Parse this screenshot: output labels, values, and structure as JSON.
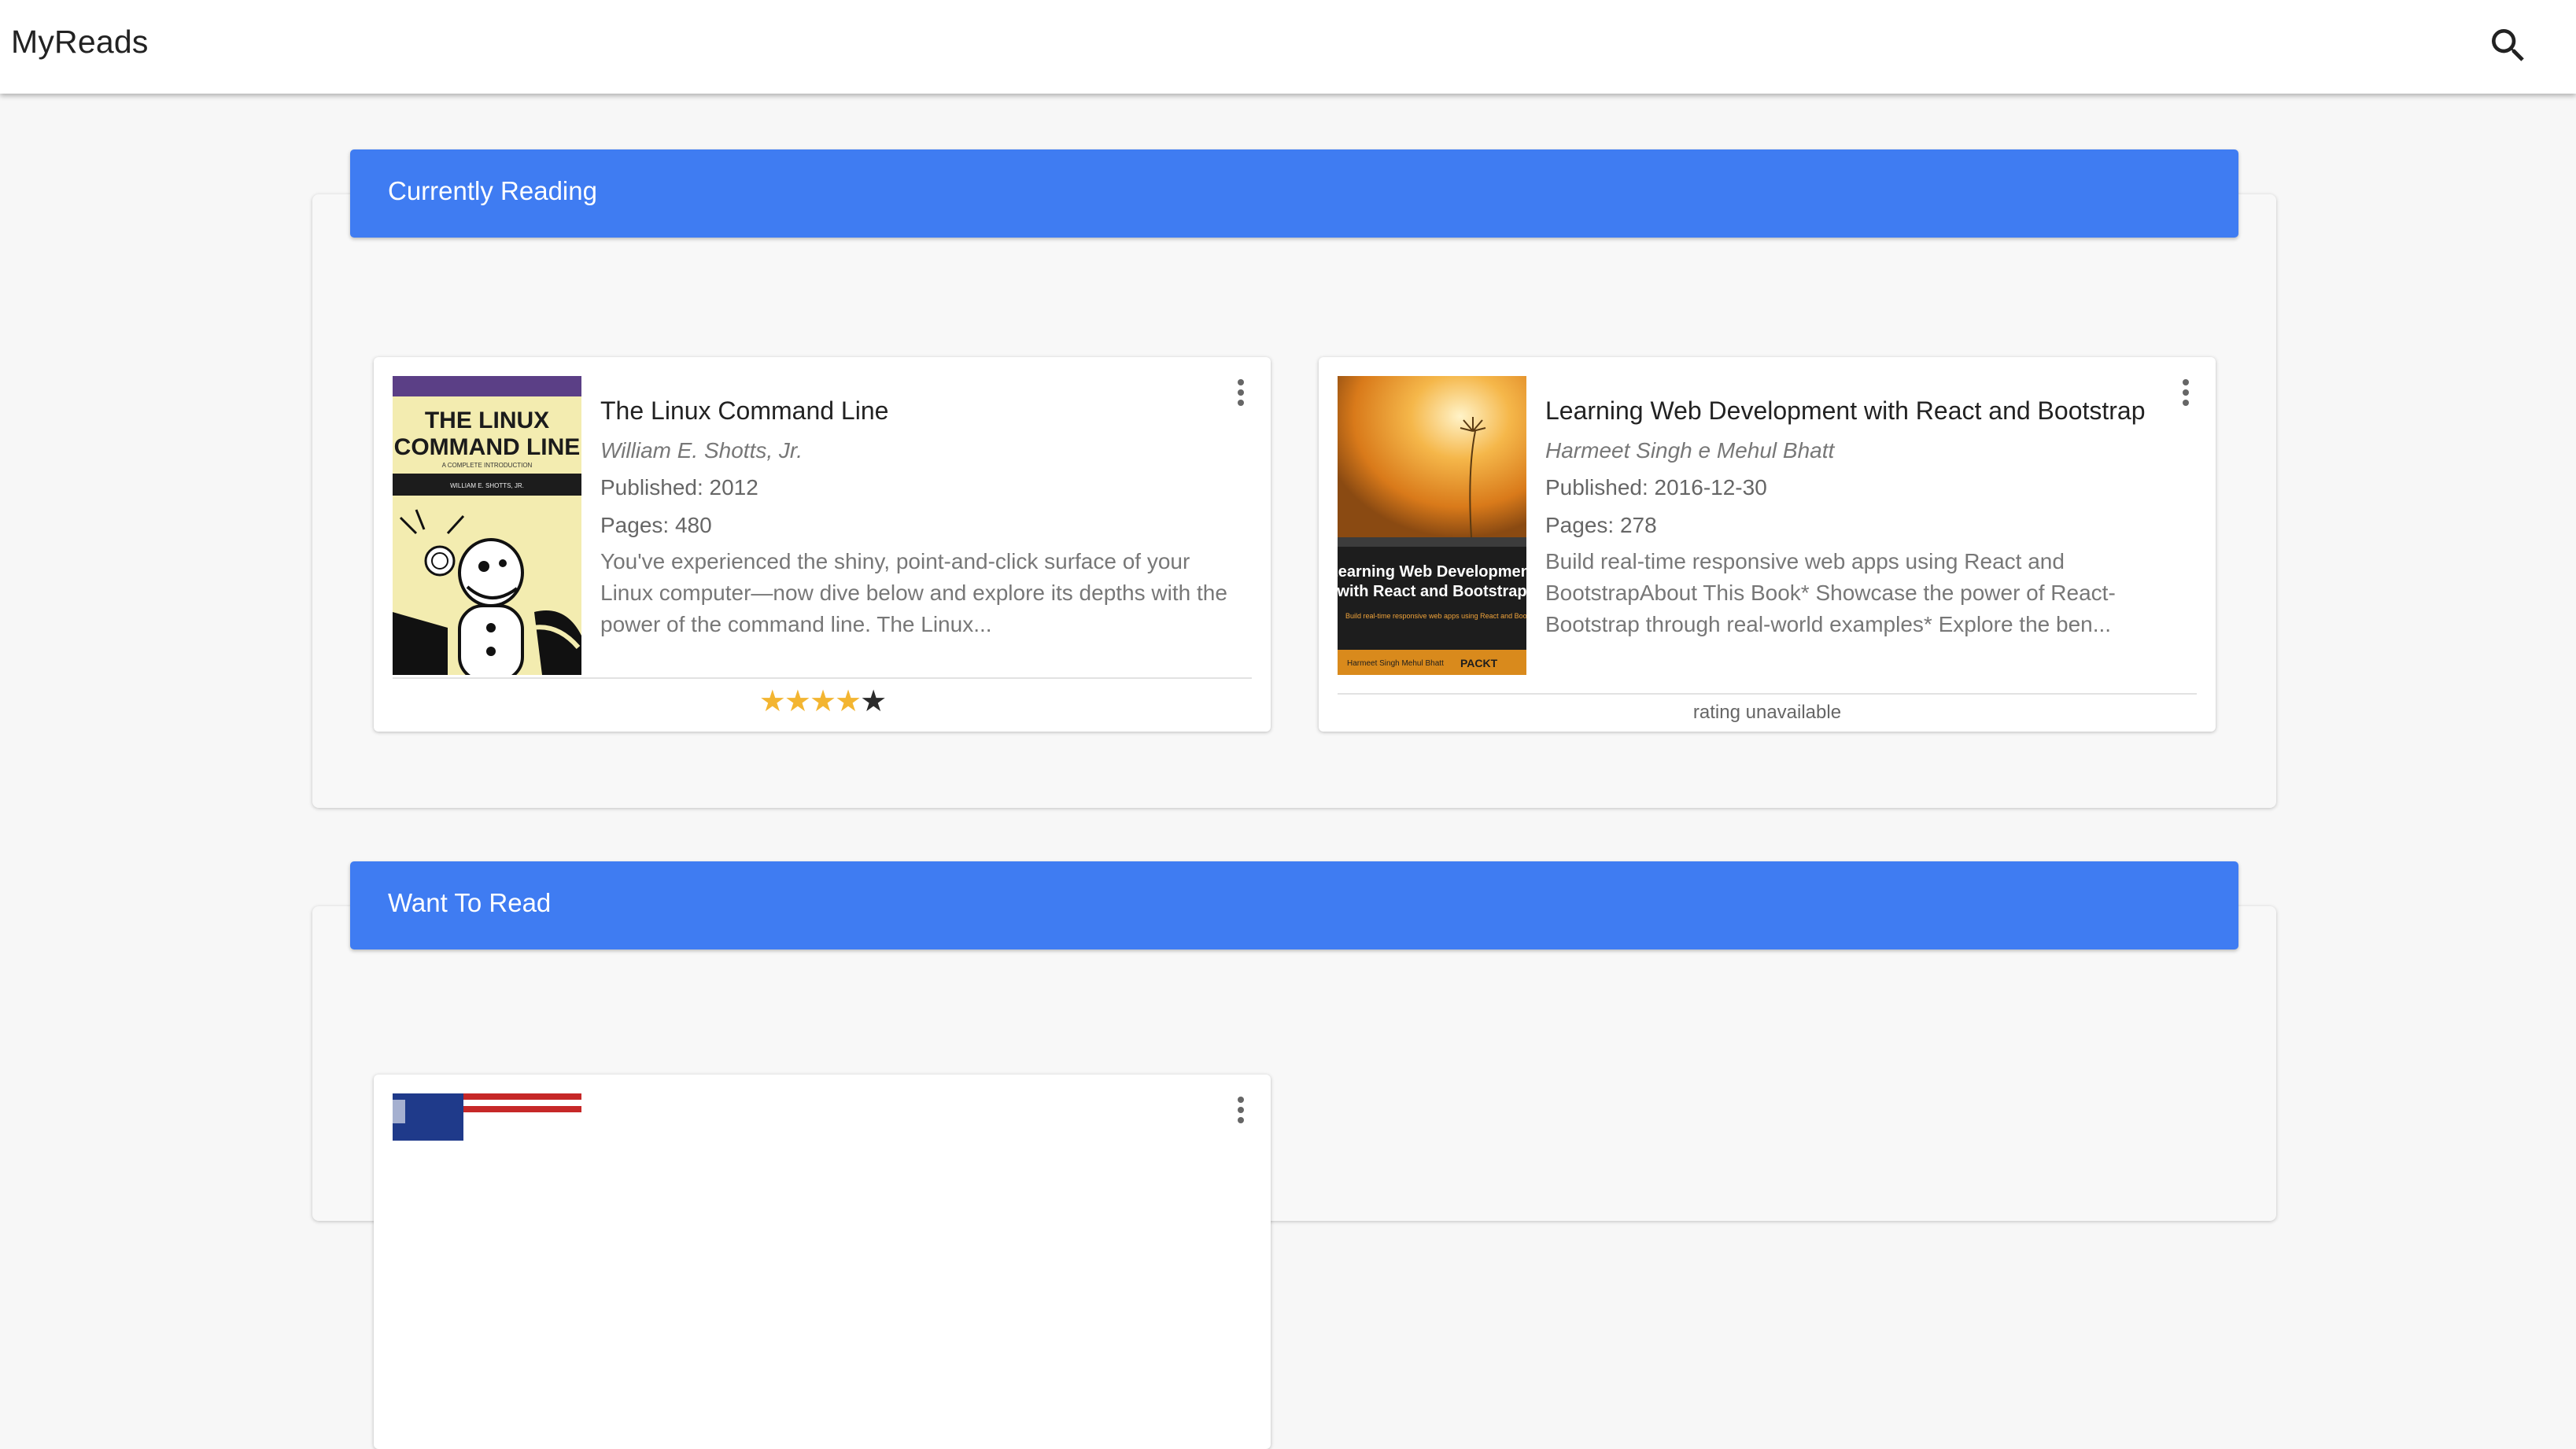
{
  "app": {
    "title": "MyReads",
    "search_icon": "search-icon"
  },
  "colors": {
    "shelf_header": "#3f7cf2",
    "star_filled": "#f3b531",
    "star_empty": "#2b2b2b"
  },
  "shelves": [
    {
      "title": "Currently Reading",
      "books": [
        {
          "title": "The Linux Command Line",
          "author": "William E. Shotts, Jr.",
          "published": "Published: 2012",
          "pages": "Pages: 480",
          "description": "You've experienced the shiny, point-and-click surface of your Linux computer—now dive below and explore its depths with the power of the command line. The Linux...",
          "rating": 4,
          "rating_max": 5,
          "cover": {
            "title": "THE LINUX COMMAND LINE",
            "subtitle": "A COMPLETE INTRODUCTION",
            "author": "WILLIAM E. SHOTTS, JR."
          }
        },
        {
          "title": "Learning Web Development with React and Bootstrap",
          "author": "Harmeet Singh e Mehul Bhatt",
          "published": "Published: 2016-12-30",
          "pages": "Pages: 278",
          "description": "Build real-time responsive web apps using React and BootstrapAbout This Book* Showcase the power of React-Bootstrap through real-world examples* Explore the ben...",
          "rating_text": "rating unavailable",
          "cover": {
            "title": "Learning Web Development with React and Bootstrap",
            "subtitle": "Build real-time responsive web apps using React and Bootstrap",
            "author": "Harmeet Singh Mehul Bhatt",
            "publisher": "PACKT"
          }
        }
      ]
    },
    {
      "title": "Want To Read"
    }
  ]
}
